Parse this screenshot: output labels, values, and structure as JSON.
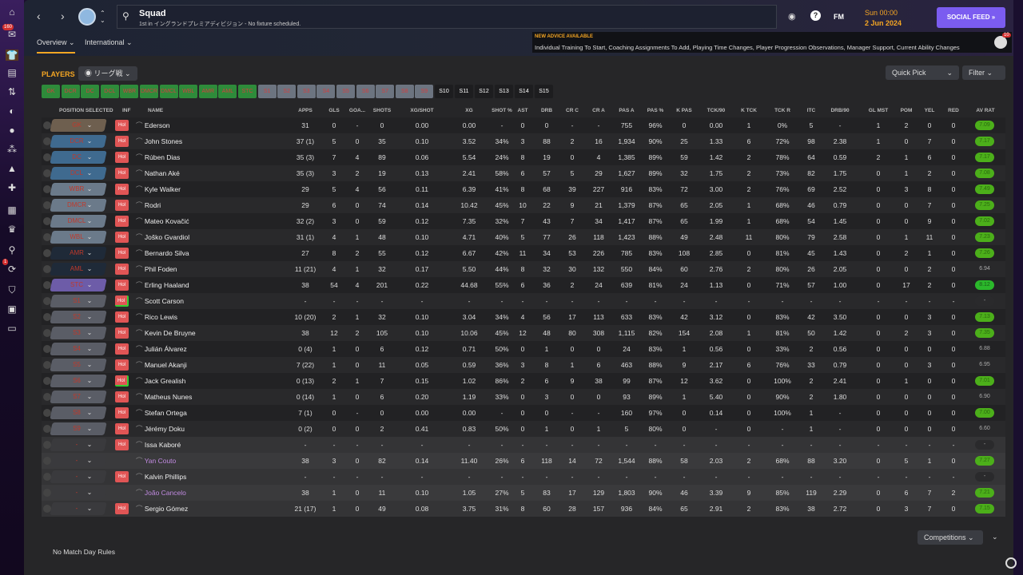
{
  "sidebar": {
    "inbox_badge": "160",
    "transfers_badge": "1",
    "icons": [
      "home-icon",
      "inbox-icon",
      "squad-icon",
      "tactics-icon",
      "staff-icon",
      "scouting-icon",
      "dynamics-icon",
      "development-icon",
      "medical-icon",
      "schedule-icon",
      "competitions-icon",
      "search-icon",
      "transfers-icon",
      "club-info-icon",
      "club-vision-icon",
      "finances-icon",
      "data-hub-icon"
    ]
  },
  "header": {
    "title": "Squad",
    "subtitle": "1st in イングランドプレミアディビジョン - No fixture scheduled.",
    "fm_label": "FM",
    "time": "Sun 00:00",
    "date": "2 Jun 2024",
    "social_feed": "SOCIAL FEED",
    "advice_title": "NEW ADVICE AVAILABLE",
    "advice_text": "Individual Training To Start, Coaching Assignments To Add, Playing Time Changes, Player Progression Observations, Manager Support, Current Ability Changes",
    "advice_badge": "10"
  },
  "tabs": [
    {
      "label": "Overview ⌄"
    },
    {
      "label": "International ⌄"
    }
  ],
  "players": {
    "title": "PLAYERS",
    "view": "リーグ戦",
    "quick_pick": "Quick Pick",
    "filter": "Filter"
  },
  "position_buttons": [
    "GK",
    "DCR",
    "DC",
    "DCL",
    "WBR",
    "DMCR",
    "DMCL",
    "WBL",
    "AMR",
    "AML",
    "STC",
    "S1",
    "S2",
    "S3",
    "S4",
    "S5",
    "S6",
    "S7",
    "S8",
    "S9",
    "S10",
    "S11",
    "S12",
    "S13",
    "S14",
    "S15"
  ],
  "columns": [
    "POSITION SELECTED",
    "INF",
    "NAME",
    "APPS",
    "GLS",
    "GOA...",
    "SHOTS",
    "XG/SHOT",
    "XG",
    "SHOT %",
    "AST",
    "DRB",
    "CR C",
    "CR A",
    "PAS A",
    "PAS %",
    "K PAS",
    "TCK/90",
    "K TCK",
    "TCK R",
    "ITC",
    "DRB/90",
    "GL MST",
    "POM",
    "YEL",
    "RED",
    "AV RAT"
  ],
  "colors": {
    "accent": "#f5a623",
    "green_rating": "#4caf1a",
    "social_feed": "#7b5cf0",
    "hol": "#e05555"
  },
  "rows": [
    {
      "pos": "GK",
      "inf": "Hol",
      "name": "Ederson",
      "stats": [
        "31",
        "0",
        "-",
        "0",
        "0.00",
        "0.00",
        "-",
        "0",
        "0",
        "-",
        "-",
        "755",
        "96%",
        "0",
        "0.00",
        "1",
        "0%",
        "5",
        "-",
        "1",
        "2",
        "0",
        "0"
      ],
      "rating": "7.09"
    },
    {
      "pos": "DCR",
      "inf": "Hol",
      "name": "John Stones",
      "stats": [
        "37 (1)",
        "5",
        "0",
        "35",
        "0.10",
        "3.52",
        "34%",
        "3",
        "88",
        "2",
        "16",
        "1,934",
        "90%",
        "25",
        "1.33",
        "6",
        "72%",
        "98",
        "2.38",
        "1",
        "0",
        "7",
        "0"
      ],
      "rating": "7.17"
    },
    {
      "pos": "DC",
      "inf": "Hol",
      "name": "Rúben Dias",
      "stats": [
        "35 (3)",
        "7",
        "4",
        "89",
        "0.06",
        "5.54",
        "24%",
        "8",
        "19",
        "0",
        "4",
        "1,385",
        "89%",
        "59",
        "1.42",
        "2",
        "78%",
        "64",
        "0.59",
        "2",
        "1",
        "6",
        "0"
      ],
      "rating": "7.17"
    },
    {
      "pos": "DCL",
      "inf": "Hol",
      "name": "Nathan Aké",
      "stats": [
        "35 (3)",
        "3",
        "2",
        "19",
        "0.13",
        "2.41",
        "58%",
        "6",
        "57",
        "5",
        "29",
        "1,627",
        "89%",
        "32",
        "1.75",
        "2",
        "73%",
        "82",
        "1.75",
        "0",
        "1",
        "2",
        "0"
      ],
      "rating": "7.08"
    },
    {
      "pos": "WBR",
      "inf": "Hol",
      "name": "Kyle Walker",
      "stats": [
        "29",
        "5",
        "4",
        "56",
        "0.11",
        "6.39",
        "41%",
        "8",
        "68",
        "39",
        "227",
        "916",
        "83%",
        "72",
        "3.00",
        "2",
        "76%",
        "69",
        "2.52",
        "0",
        "3",
        "8",
        "0"
      ],
      "rating": "7.49"
    },
    {
      "pos": "DMCR",
      "inf": "Hol",
      "name": "Rodri",
      "stats": [
        "29",
        "6",
        "0",
        "74",
        "0.14",
        "10.42",
        "45%",
        "10",
        "22",
        "9",
        "21",
        "1,379",
        "87%",
        "65",
        "2.05",
        "1",
        "68%",
        "46",
        "0.79",
        "0",
        "0",
        "7",
        "0"
      ],
      "rating": "7.25"
    },
    {
      "pos": "DMCL",
      "inf": "Hol",
      "name": "Mateo Kovačić",
      "stats": [
        "32 (2)",
        "3",
        "0",
        "59",
        "0.12",
        "7.35",
        "32%",
        "7",
        "43",
        "7",
        "34",
        "1,417",
        "87%",
        "65",
        "1.99",
        "1",
        "68%",
        "54",
        "1.45",
        "0",
        "0",
        "9",
        "0"
      ],
      "rating": "7.02"
    },
    {
      "pos": "WBL",
      "inf": "Hol",
      "name": "Joško Gvardiol",
      "stats": [
        "31 (1)",
        "4",
        "1",
        "48",
        "0.10",
        "4.71",
        "40%",
        "5",
        "77",
        "26",
        "118",
        "1,423",
        "88%",
        "49",
        "2.48",
        "11",
        "80%",
        "79",
        "2.58",
        "0",
        "1",
        "11",
        "0"
      ],
      "rating": "7.23"
    },
    {
      "pos": "AMR",
      "inf": "Hol",
      "name": "Bernardo Silva",
      "stats": [
        "27",
        "8",
        "2",
        "55",
        "0.12",
        "6.67",
        "42%",
        "11",
        "34",
        "53",
        "226",
        "785",
        "83%",
        "108",
        "2.85",
        "0",
        "81%",
        "45",
        "1.43",
        "0",
        "2",
        "1",
        "0"
      ],
      "rating": "7.26"
    },
    {
      "pos": "AML",
      "inf": "Hol",
      "name": "Phil Foden",
      "stats": [
        "11 (21)",
        "4",
        "1",
        "32",
        "0.17",
        "5.50",
        "44%",
        "8",
        "32",
        "30",
        "132",
        "550",
        "84%",
        "60",
        "2.76",
        "2",
        "80%",
        "26",
        "2.05",
        "0",
        "0",
        "2",
        "0"
      ],
      "rating": "6.94"
    },
    {
      "pos": "STC",
      "inf": "Hol",
      "name": "Erling Haaland",
      "stats": [
        "38",
        "54",
        "4",
        "201",
        "0.22",
        "44.68",
        "55%",
        "6",
        "36",
        "2",
        "24",
        "639",
        "81%",
        "24",
        "1.13",
        "0",
        "71%",
        "57",
        "1.00",
        "0",
        "17",
        "2",
        "0"
      ],
      "rating": "8.12"
    },
    {
      "pos": "S1",
      "inf": "Hol",
      "name": "Scott Carson",
      "stats": [
        "-",
        "-",
        "-",
        "-",
        "-",
        "-",
        "-",
        "-",
        "-",
        "-",
        "-",
        "-",
        "-",
        "-",
        "-",
        "-",
        "-",
        "-",
        "-",
        "-",
        "-",
        "-",
        "-"
      ],
      "rating": "-"
    },
    {
      "pos": "S2",
      "inf": "Hol",
      "name": "Rico Lewis",
      "stats": [
        "10 (20)",
        "2",
        "1",
        "32",
        "0.10",
        "3.04",
        "34%",
        "4",
        "56",
        "17",
        "113",
        "633",
        "83%",
        "42",
        "3.12",
        "0",
        "83%",
        "42",
        "3.50",
        "0",
        "0",
        "3",
        "0"
      ],
      "rating": "7.13"
    },
    {
      "pos": "S3",
      "inf": "Hol",
      "name": "Kevin De Bruyne",
      "stats": [
        "38",
        "12",
        "2",
        "105",
        "0.10",
        "10.06",
        "45%",
        "12",
        "48",
        "80",
        "308",
        "1,115",
        "82%",
        "154",
        "2.08",
        "1",
        "81%",
        "50",
        "1.42",
        "0",
        "2",
        "3",
        "0"
      ],
      "rating": "7.35"
    },
    {
      "pos": "S4",
      "inf": "Hol",
      "name": "Julián Álvarez",
      "stats": [
        "0 (4)",
        "1",
        "0",
        "6",
        "0.12",
        "0.71",
        "50%",
        "0",
        "1",
        "0",
        "0",
        "24",
        "83%",
        "1",
        "0.56",
        "0",
        "33%",
        "2",
        "0.56",
        "0",
        "0",
        "0",
        "0"
      ],
      "rating": "6.88"
    },
    {
      "pos": "S5",
      "inf": "Hol",
      "name": "Manuel Akanji",
      "stats": [
        "7 (22)",
        "1",
        "0",
        "11",
        "0.05",
        "0.59",
        "36%",
        "3",
        "8",
        "1",
        "6",
        "463",
        "88%",
        "9",
        "2.17",
        "6",
        "76%",
        "33",
        "0.79",
        "0",
        "0",
        "3",
        "0"
      ],
      "rating": "6.95"
    },
    {
      "pos": "S6",
      "inf": "Hol",
      "name": "Jack Grealish",
      "stats": [
        "0 (13)",
        "2",
        "1",
        "7",
        "0.15",
        "1.02",
        "86%",
        "2",
        "6",
        "9",
        "38",
        "99",
        "87%",
        "12",
        "3.62",
        "0",
        "100%",
        "2",
        "2.41",
        "0",
        "1",
        "0",
        "0"
      ],
      "rating": "7.01"
    },
    {
      "pos": "S7",
      "inf": "Hol",
      "name": "Matheus Nunes",
      "stats": [
        "0 (14)",
        "1",
        "0",
        "6",
        "0.20",
        "1.19",
        "33%",
        "0",
        "3",
        "0",
        "0",
        "93",
        "89%",
        "1",
        "5.40",
        "0",
        "90%",
        "2",
        "1.80",
        "0",
        "0",
        "0",
        "0"
      ],
      "rating": "6.90"
    },
    {
      "pos": "S8",
      "inf": "Hol",
      "name": "Stefan Ortega",
      "stats": [
        "7 (1)",
        "0",
        "-",
        "0",
        "0.00",
        "0.00",
        "-",
        "0",
        "0",
        "-",
        "-",
        "160",
        "97%",
        "0",
        "0.14",
        "0",
        "100%",
        "1",
        "-",
        "0",
        "0",
        "0",
        "0"
      ],
      "rating": "7.00"
    },
    {
      "pos": "S9",
      "inf": "Hol",
      "name": "Jérémy Doku",
      "stats": [
        "0 (2)",
        "0",
        "0",
        "2",
        "0.41",
        "0.83",
        "50%",
        "0",
        "1",
        "0",
        "1",
        "5",
        "80%",
        "0",
        "-",
        "0",
        "-",
        "1",
        "-",
        "0",
        "0",
        "0",
        "0"
      ],
      "rating": "6.60"
    },
    {
      "pos": "-",
      "inf": "Hol",
      "name": "Issa Kaboré",
      "stats": [
        "-",
        "-",
        "-",
        "-",
        "-",
        "-",
        "-",
        "-",
        "-",
        "-",
        "-",
        "-",
        "-",
        "-",
        "-",
        "-",
        "-",
        "-",
        "-",
        "-",
        "-",
        "-",
        "-"
      ],
      "rating": "-"
    },
    {
      "pos": "-",
      "inf": "",
      "name": "Yan Couto",
      "loan": true,
      "stats": [
        "38",
        "3",
        "0",
        "82",
        "0.14",
        "11.40",
        "26%",
        "6",
        "118",
        "14",
        "72",
        "1,544",
        "88%",
        "58",
        "2.03",
        "2",
        "68%",
        "88",
        "3.20",
        "0",
        "5",
        "1",
        "0"
      ],
      "rating": "7.27"
    },
    {
      "pos": "-",
      "inf": "Hol",
      "name": "Kalvin Phillips",
      "stats": [
        "-",
        "-",
        "-",
        "-",
        "-",
        "-",
        "-",
        "-",
        "-",
        "-",
        "-",
        "-",
        "-",
        "-",
        "-",
        "-",
        "-",
        "-",
        "-",
        "-",
        "-",
        "-",
        "-"
      ],
      "rating": "-"
    },
    {
      "pos": "-",
      "inf": "",
      "name": "João Cancelo",
      "loan": true,
      "stats": [
        "38",
        "1",
        "0",
        "11",
        "0.10",
        "1.05",
        "27%",
        "5",
        "83",
        "17",
        "129",
        "1,803",
        "90%",
        "46",
        "3.39",
        "9",
        "85%",
        "119",
        "2.29",
        "0",
        "6",
        "7",
        "2"
      ],
      "rating": "7.21"
    },
    {
      "pos": "-",
      "inf": "Hol",
      "name": "Sergio Gómez",
      "stats": [
        "21 (17)",
        "1",
        "0",
        "49",
        "0.08",
        "3.75",
        "31%",
        "8",
        "60",
        "28",
        "157",
        "936",
        "84%",
        "65",
        "2.91",
        "2",
        "83%",
        "38",
        "2.72",
        "0",
        "3",
        "7",
        "0"
      ],
      "rating": "7.15"
    }
  ],
  "footer": {
    "rules": "No Match Day Rules",
    "competitions": "Competitions"
  }
}
